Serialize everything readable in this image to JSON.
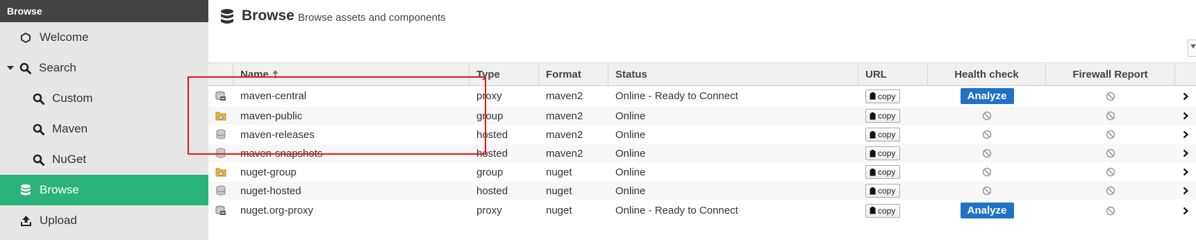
{
  "sidebar": {
    "header": "Browse",
    "items": [
      {
        "label": "Welcome",
        "icon": "hexagon-icon"
      },
      {
        "label": "Search",
        "icon": "search-icon"
      },
      {
        "label": "Custom",
        "icon": "search-icon"
      },
      {
        "label": "Maven",
        "icon": "search-icon"
      },
      {
        "label": "NuGet",
        "icon": "search-icon"
      },
      {
        "label": "Browse",
        "icon": "database-icon"
      },
      {
        "label": "Upload",
        "icon": "upload-icon"
      }
    ]
  },
  "page": {
    "title": "Browse",
    "subtitle": "Browse assets and components"
  },
  "table": {
    "headers": {
      "name": "Name",
      "sort_icon": "sort-asc-icon",
      "type": "Type",
      "format": "Format",
      "status": "Status",
      "url": "URL",
      "health": "Health check",
      "firewall": "Firewall Report"
    },
    "copy_label": "copy",
    "analyze_label": "Analyze",
    "rows": [
      {
        "icon": "proxy-repo-icon",
        "name": "maven-central",
        "type": "proxy",
        "format": "maven2",
        "status": "Online - Ready to Connect",
        "health": "analyze"
      },
      {
        "icon": "group-repo-icon",
        "name": "maven-public",
        "type": "group",
        "format": "maven2",
        "status": "Online",
        "health": "disabled"
      },
      {
        "icon": "hosted-repo-icon",
        "name": "maven-releases",
        "type": "hosted",
        "format": "maven2",
        "status": "Online",
        "health": "disabled"
      },
      {
        "icon": "hosted-repo-icon",
        "name": "maven-snapshots",
        "type": "hosted",
        "format": "maven2",
        "status": "Online",
        "health": "disabled"
      },
      {
        "icon": "group-repo-icon",
        "name": "nuget-group",
        "type": "group",
        "format": "nuget",
        "status": "Online",
        "health": "disabled"
      },
      {
        "icon": "hosted-repo-icon",
        "name": "nuget-hosted",
        "type": "hosted",
        "format": "nuget",
        "status": "Online",
        "health": "disabled"
      },
      {
        "icon": "proxy-repo-icon",
        "name": "nuget.org-proxy",
        "type": "proxy",
        "format": "nuget",
        "status": "Online - Ready to Connect",
        "health": "analyze"
      }
    ]
  },
  "colors": {
    "sidebar_active": "#2ab27b",
    "analyze_button": "#1f73c6",
    "highlight": "#e11111"
  }
}
